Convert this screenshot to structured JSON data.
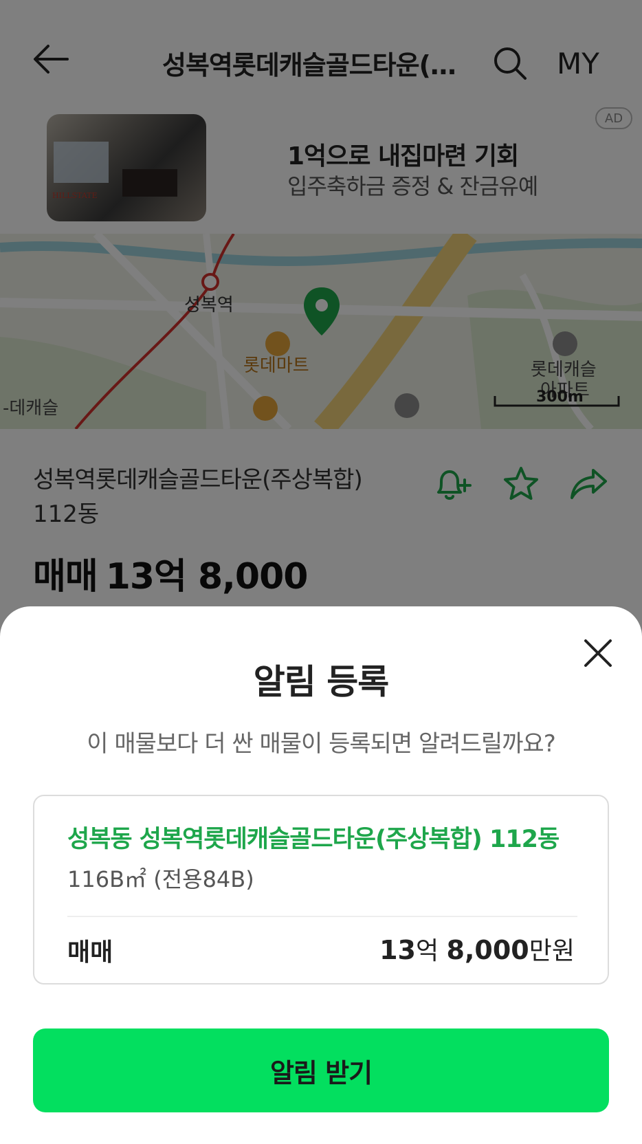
{
  "header": {
    "title": "성복역롯데캐슬골드타운(…",
    "my_label": "MY"
  },
  "ad": {
    "badge": "AD",
    "title": "1억으로 내집마련 기회",
    "subtitle": "입주축하금 증정 & 잔금유예",
    "thumb_logo": "HILLSTATE"
  },
  "map": {
    "labels": {
      "station": "성복역",
      "mart": "롯데마트",
      "apt_line1": "롯데캐슬",
      "apt_line2": "아파트",
      "left_edge": "-데캐슬",
      "scale": "300m"
    },
    "colors": {
      "pin": "#1ea64b",
      "stream": "#9fd3dc",
      "road": "#f3d37a",
      "rail": "#d0302c"
    }
  },
  "listing": {
    "name": "성복역롯데캐슬골드타운(주상복합)",
    "dong": "112동",
    "price_type": "매매",
    "price": "13억 8,000"
  },
  "sheet": {
    "title": "알림 등록",
    "description": "이 매물보다 더 싼 매물이 등록되면 알려드릴까요?",
    "card": {
      "name": "성복동 성복역롯데캐슬골드타운(주상복합) 112동",
      "area": "116B㎡ (전용84B)",
      "deal_type": "매매",
      "price_eok_num": "13",
      "price_eok_unit": "억",
      "price_man_num": "8,000",
      "price_man_unit": "만원"
    },
    "cta_label": "알림 받기",
    "accent_color": "#03df5f"
  }
}
